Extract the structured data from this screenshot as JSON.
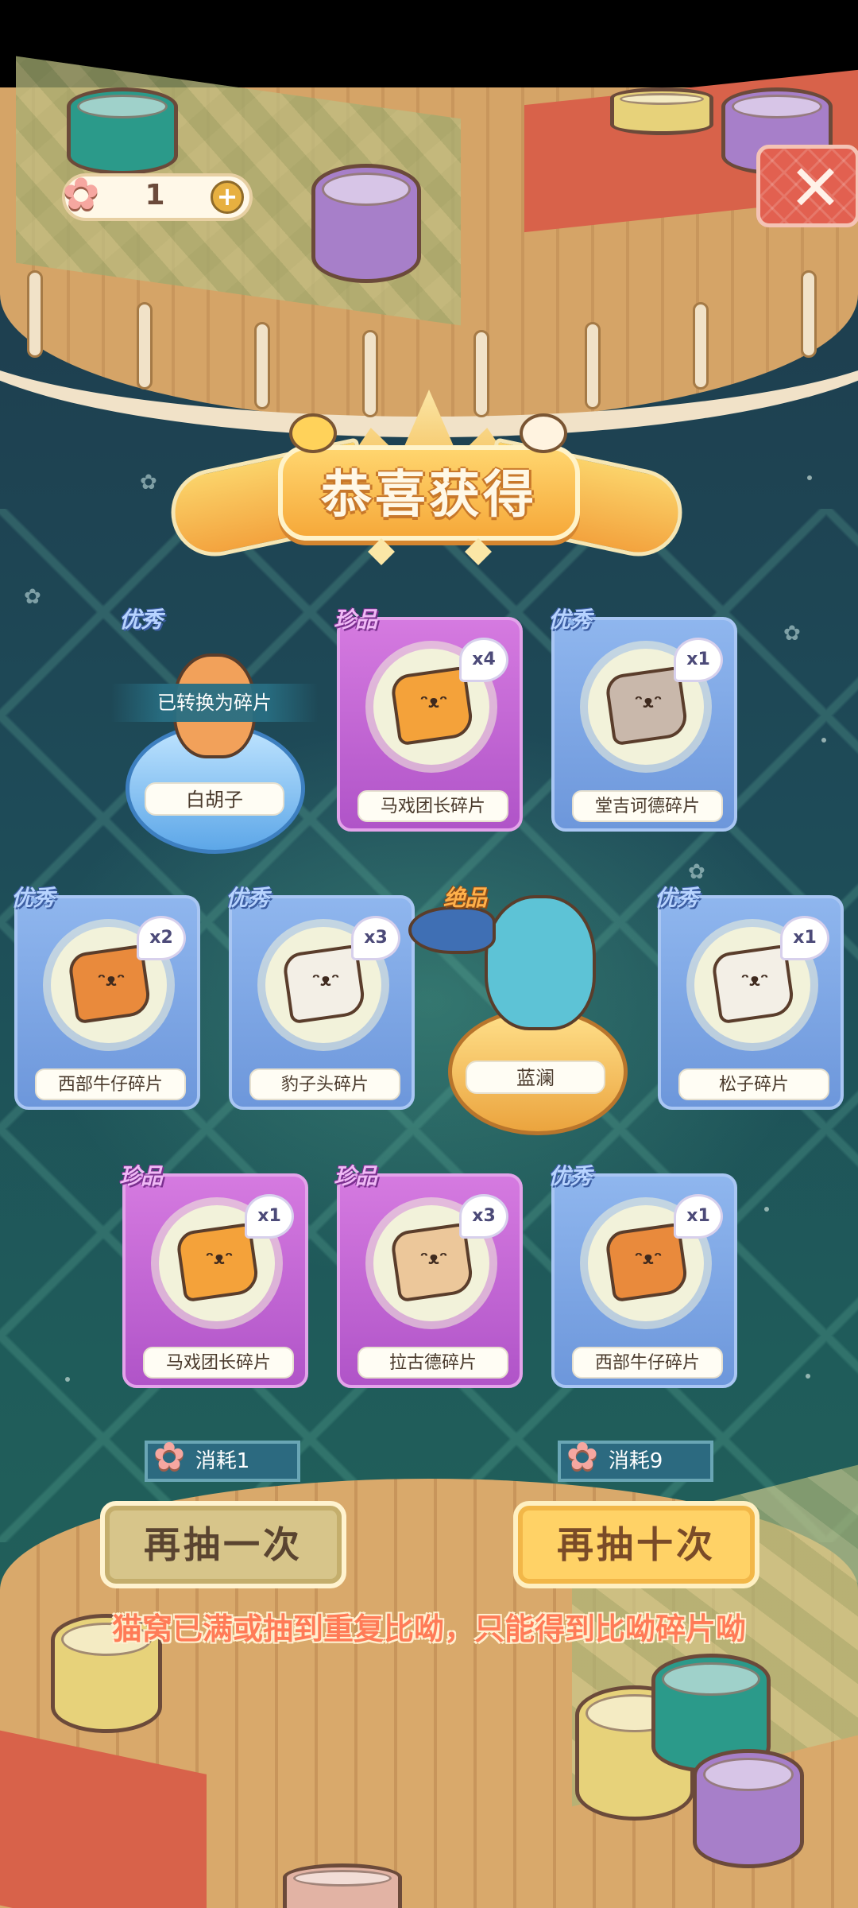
{
  "hud": {
    "ticket_icon": "cat-paw-ticket-icon",
    "ticket_count": "1",
    "plus_label": "+",
    "close_label": "✕"
  },
  "title": {
    "text": "恭喜获得"
  },
  "rewards": [
    {
      "rarity": "优秀",
      "name": "白胡子",
      "type": "character",
      "status": "已转换为碎片"
    },
    {
      "rarity": "珍品",
      "name": "马戏团长碎片",
      "qty": "x4",
      "type": "fragment"
    },
    {
      "rarity": "优秀",
      "name": "堂吉诃德碎片",
      "qty": "x1",
      "type": "fragment"
    },
    {
      "rarity": "优秀",
      "name": "西部牛仔碎片",
      "qty": "x2",
      "type": "fragment"
    },
    {
      "rarity": "优秀",
      "name": "豹子头碎片",
      "qty": "x3",
      "type": "fragment"
    },
    {
      "rarity": "绝品",
      "name": "蓝澜",
      "type": "character"
    },
    {
      "rarity": "优秀",
      "name": "松子碎片",
      "qty": "x1",
      "type": "fragment"
    },
    {
      "rarity": "珍品",
      "name": "马戏团长碎片",
      "qty": "x1",
      "type": "fragment"
    },
    {
      "rarity": "珍品",
      "name": "拉古德碎片",
      "qty": "x3",
      "type": "fragment"
    },
    {
      "rarity": "优秀",
      "name": "西部牛仔碎片",
      "qty": "x1",
      "type": "fragment"
    }
  ],
  "actions": {
    "once": {
      "cost": "消耗1",
      "label": "再抽一次"
    },
    "ten": {
      "cost": "消耗9",
      "label": "再抽十次"
    }
  },
  "notice": "猫窝已满或抽到重复比呦，只能得到比呦碎片呦",
  "colors": {
    "rarity_excellent": "#8fb6ee",
    "rarity_treasure": "#d57ae0",
    "rarity_legendary": "#ffb04a",
    "notice": "#ff7b57"
  }
}
